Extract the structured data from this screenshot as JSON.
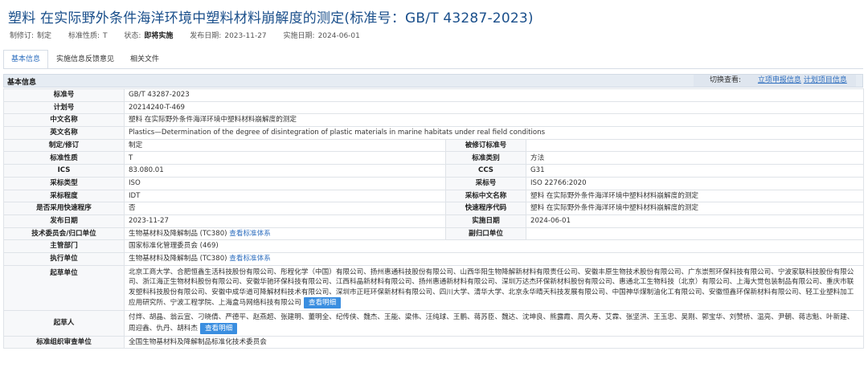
{
  "title": "塑料 在实际野外条件海洋环境中塑料材料崩解度的测定(标准号：GB/T 43287-2023)",
  "meta": {
    "revise_label": "制修订:",
    "revise_value": "制定",
    "nature_label": "标准性质:",
    "nature_value": "T",
    "status_label": "状态:",
    "status_value": "即将实施",
    "publish_label": "发布日期:",
    "publish_value": "2023-11-27",
    "implement_label": "实施日期:",
    "implement_value": "2024-06-01"
  },
  "tabs": [
    {
      "label": "基本信息"
    },
    {
      "label": "实施信息反馈意见"
    },
    {
      "label": "相关文件"
    }
  ],
  "section": {
    "title": "基本信息",
    "switch_label": "切换查看:",
    "link1": "立项申报信息",
    "link2": "计划项目信息"
  },
  "rows": {
    "std_no": {
      "k": "标准号",
      "v": "GB/T 43287-2023"
    },
    "plan_no": {
      "k": "计划号",
      "v": "20214240-T-469"
    },
    "cn_name": {
      "k": "中文名称",
      "v": "塑料 在实际野外条件海洋环境中塑料材料崩解度的测定"
    },
    "en_name": {
      "k": "英文名称",
      "v": "Plastics—Determination of the degree of disintegration of plastic materials in marine habitats under real field conditions"
    },
    "revise": {
      "k": "制定/修订",
      "v": "制定",
      "k2": "被修订标准号",
      "v2": ""
    },
    "nature": {
      "k": "标准性质",
      "v": "T",
      "k2": "标准类别",
      "v2": "方法"
    },
    "ics": {
      "k": "ICS",
      "v": "83.080.01",
      "k2": "CCS",
      "v2": "G31"
    },
    "adopt_type": {
      "k": "采标类型",
      "v": "ISO",
      "k2": "采标号",
      "v2": "ISO 22766:2020"
    },
    "adopt_degree": {
      "k": "采标程度",
      "v": "IDT",
      "k2": "采标中文名称",
      "v2": "塑料 在实际野外条件海洋环境中塑料材料崩解度的测定"
    },
    "fast": {
      "k": "是否采用快速程序",
      "v": "否",
      "k2": "快速程序代码",
      "v2": "塑料 在实际野外条件海洋环境中塑料材料崩解度的测定"
    },
    "dates": {
      "k": "发布日期",
      "v": "2023-11-27",
      "k2": "实施日期",
      "v2": "2024-06-01"
    },
    "tc": {
      "k": "技术委员会/归口单位",
      "v": "生物基材料及降解制品 (TC380)",
      "link": "查看标准体系",
      "k2": "副归口单位",
      "v2": ""
    },
    "dept": {
      "k": "主管部门",
      "v": "国家标准化管理委员会 (469)"
    },
    "exec": {
      "k": "执行单位",
      "v": "生物基材料及降解制品 (TC380)",
      "link": "查看标准体系"
    },
    "drafter_units": {
      "k": "起草单位",
      "v": "北京工商大学、合肥恒鑫生活科技股份有限公司、彤程化学（中国）有限公司、扬州惠通科技股份有限公司、山西华阳生物降解新材料有限责任公司、安徽丰原生物技术股份有限公司、广东崇熙环保科技有限公司、宁波家联科技股份有限公司、浙江海正生物材料股份有限公司、安徽华驰环保科技有限公司、江西科晶新材料有限公司、扬州惠通新材料有限公司、深圳万达杰环保新材料股份有限公司、惠通北工生物科技（北京）有限公司、上海大觉包装制品有限公司、重庆市联发塑料科技股份有限公司、安徽中成华道可降解材料技术有限公司、深圳市正旺环保新材料有限公司、四川大学、清华大学、北京永华晴天科技发展有限公司、中国神华煤制油化工有限公司、安徽恒鑫环保新材料有限公司、轻工业塑料加工应用研究所、宁波工程学院、上海盒马网络科技有限公司",
      "btn": "查看明细"
    },
    "drafters": {
      "k": "起草人",
      "v": "付烨、胡晶、翁云宣、刁晓倩、严德平、赵燕超、张建明、董明全、纪传侠、魏杰、王能、梁伟、汪纯球、王鹏、蒋苏臣、魏达、沈坤良、熊露霞、周久寿、艾霖、张坚洪、王玉忠、吴刚、郭宝华、刘赞桥、温亮、尹朝、蒋志魁、叶新建、周迎鑫、仇丹、胡科杰",
      "btn": "查看明细"
    },
    "review_org": {
      "k": "标准组织审查单位",
      "v": "全国生物基材料及降解制品标准化技术委员会"
    }
  }
}
